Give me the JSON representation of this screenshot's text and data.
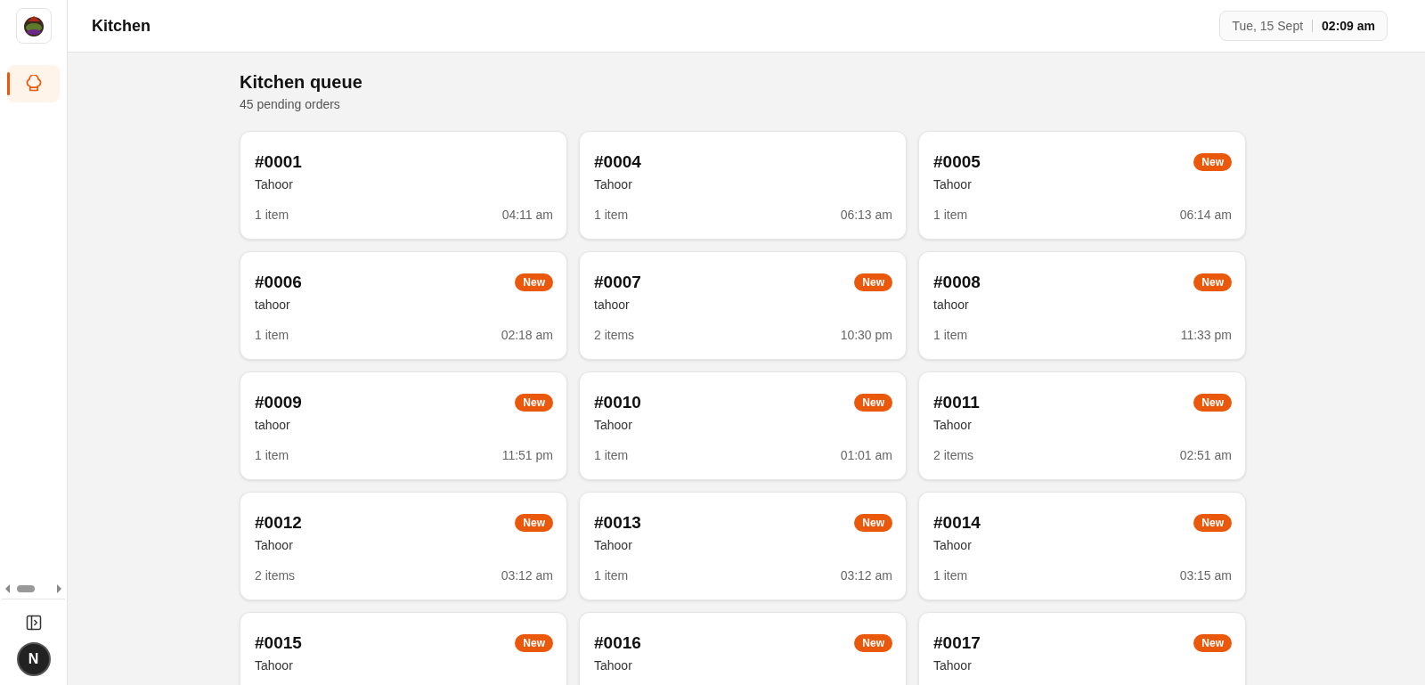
{
  "header": {
    "title": "Kitchen",
    "date": "Tue, 15 Sept",
    "time": "02:09 am"
  },
  "sidebar": {
    "items": [
      {
        "selected": true
      }
    ],
    "avatar": "N"
  },
  "queue": {
    "title": "Kitchen queue",
    "subtitle": "45 pending orders"
  },
  "orders": [
    {
      "number": "#0001",
      "customer": "Tahoor",
      "items": "1 item",
      "time": "04:11 am",
      "new": false
    },
    {
      "number": "#0004",
      "customer": "Tahoor",
      "items": "1 item",
      "time": "06:13 am",
      "new": false
    },
    {
      "number": "#0005",
      "customer": "Tahoor",
      "items": "1 item",
      "time": "06:14 am",
      "new": true,
      "badge": "New"
    },
    {
      "number": "#0006",
      "customer": "tahoor",
      "items": "1 item",
      "time": "02:18 am",
      "new": true,
      "badge": "New"
    },
    {
      "number": "#0007",
      "customer": "tahoor",
      "items": "2 items",
      "time": "10:30 pm",
      "new": true,
      "badge": "New"
    },
    {
      "number": "#0008",
      "customer": "tahoor",
      "items": "1 item",
      "time": "11:33 pm",
      "new": true,
      "badge": "New"
    },
    {
      "number": "#0009",
      "customer": "tahoor",
      "items": "1 item",
      "time": "11:51 pm",
      "new": true,
      "badge": "New"
    },
    {
      "number": "#0010",
      "customer": "Tahoor",
      "items": "1 item",
      "time": "01:01 am",
      "new": true,
      "badge": "New"
    },
    {
      "number": "#0011",
      "customer": "Tahoor",
      "items": "2 items",
      "time": "02:51 am",
      "new": true,
      "badge": "New"
    },
    {
      "number": "#0012",
      "customer": "Tahoor",
      "items": "2 items",
      "time": "03:12 am",
      "new": true,
      "badge": "New"
    },
    {
      "number": "#0013",
      "customer": "Tahoor",
      "items": "1 item",
      "time": "03:12 am",
      "new": true,
      "badge": "New"
    },
    {
      "number": "#0014",
      "customer": "Tahoor",
      "items": "1 item",
      "time": "03:15 am",
      "new": true,
      "badge": "New"
    },
    {
      "number": "#0015",
      "customer": "Tahoor",
      "new": true,
      "badge": "New"
    },
    {
      "number": "#0016",
      "customer": "Tahoor",
      "new": true,
      "badge": "New"
    },
    {
      "number": "#0017",
      "customer": "Tahoor",
      "new": true,
      "badge": "New"
    }
  ]
}
